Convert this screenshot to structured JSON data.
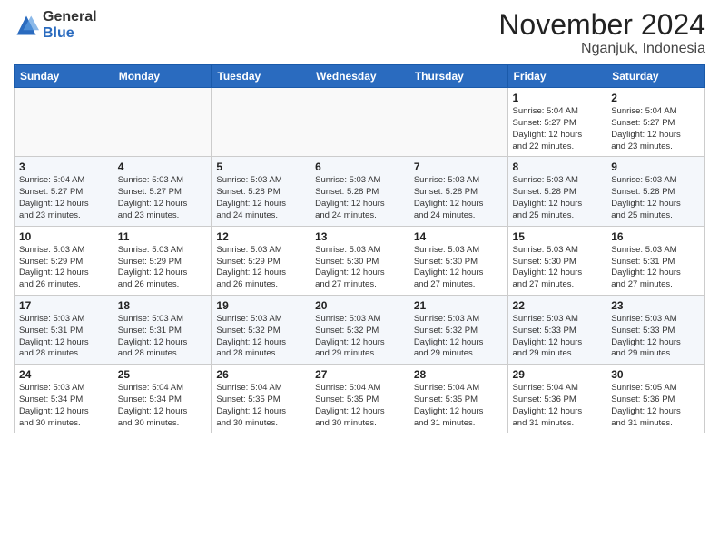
{
  "logo": {
    "general": "General",
    "blue": "Blue"
  },
  "title": "November 2024",
  "location": "Nganjuk, Indonesia",
  "days_of_week": [
    "Sunday",
    "Monday",
    "Tuesday",
    "Wednesday",
    "Thursday",
    "Friday",
    "Saturday"
  ],
  "weeks": [
    [
      {
        "day": "",
        "info": ""
      },
      {
        "day": "",
        "info": ""
      },
      {
        "day": "",
        "info": ""
      },
      {
        "day": "",
        "info": ""
      },
      {
        "day": "",
        "info": ""
      },
      {
        "day": "1",
        "info": "Sunrise: 5:04 AM\nSunset: 5:27 PM\nDaylight: 12 hours\nand 22 minutes."
      },
      {
        "day": "2",
        "info": "Sunrise: 5:04 AM\nSunset: 5:27 PM\nDaylight: 12 hours\nand 23 minutes."
      }
    ],
    [
      {
        "day": "3",
        "info": "Sunrise: 5:04 AM\nSunset: 5:27 PM\nDaylight: 12 hours\nand 23 minutes."
      },
      {
        "day": "4",
        "info": "Sunrise: 5:03 AM\nSunset: 5:27 PM\nDaylight: 12 hours\nand 23 minutes."
      },
      {
        "day": "5",
        "info": "Sunrise: 5:03 AM\nSunset: 5:28 PM\nDaylight: 12 hours\nand 24 minutes."
      },
      {
        "day": "6",
        "info": "Sunrise: 5:03 AM\nSunset: 5:28 PM\nDaylight: 12 hours\nand 24 minutes."
      },
      {
        "day": "7",
        "info": "Sunrise: 5:03 AM\nSunset: 5:28 PM\nDaylight: 12 hours\nand 24 minutes."
      },
      {
        "day": "8",
        "info": "Sunrise: 5:03 AM\nSunset: 5:28 PM\nDaylight: 12 hours\nand 25 minutes."
      },
      {
        "day": "9",
        "info": "Sunrise: 5:03 AM\nSunset: 5:28 PM\nDaylight: 12 hours\nand 25 minutes."
      }
    ],
    [
      {
        "day": "10",
        "info": "Sunrise: 5:03 AM\nSunset: 5:29 PM\nDaylight: 12 hours\nand 26 minutes."
      },
      {
        "day": "11",
        "info": "Sunrise: 5:03 AM\nSunset: 5:29 PM\nDaylight: 12 hours\nand 26 minutes."
      },
      {
        "day": "12",
        "info": "Sunrise: 5:03 AM\nSunset: 5:29 PM\nDaylight: 12 hours\nand 26 minutes."
      },
      {
        "day": "13",
        "info": "Sunrise: 5:03 AM\nSunset: 5:30 PM\nDaylight: 12 hours\nand 27 minutes."
      },
      {
        "day": "14",
        "info": "Sunrise: 5:03 AM\nSunset: 5:30 PM\nDaylight: 12 hours\nand 27 minutes."
      },
      {
        "day": "15",
        "info": "Sunrise: 5:03 AM\nSunset: 5:30 PM\nDaylight: 12 hours\nand 27 minutes."
      },
      {
        "day": "16",
        "info": "Sunrise: 5:03 AM\nSunset: 5:31 PM\nDaylight: 12 hours\nand 27 minutes."
      }
    ],
    [
      {
        "day": "17",
        "info": "Sunrise: 5:03 AM\nSunset: 5:31 PM\nDaylight: 12 hours\nand 28 minutes."
      },
      {
        "day": "18",
        "info": "Sunrise: 5:03 AM\nSunset: 5:31 PM\nDaylight: 12 hours\nand 28 minutes."
      },
      {
        "day": "19",
        "info": "Sunrise: 5:03 AM\nSunset: 5:32 PM\nDaylight: 12 hours\nand 28 minutes."
      },
      {
        "day": "20",
        "info": "Sunrise: 5:03 AM\nSunset: 5:32 PM\nDaylight: 12 hours\nand 29 minutes."
      },
      {
        "day": "21",
        "info": "Sunrise: 5:03 AM\nSunset: 5:32 PM\nDaylight: 12 hours\nand 29 minutes."
      },
      {
        "day": "22",
        "info": "Sunrise: 5:03 AM\nSunset: 5:33 PM\nDaylight: 12 hours\nand 29 minutes."
      },
      {
        "day": "23",
        "info": "Sunrise: 5:03 AM\nSunset: 5:33 PM\nDaylight: 12 hours\nand 29 minutes."
      }
    ],
    [
      {
        "day": "24",
        "info": "Sunrise: 5:03 AM\nSunset: 5:34 PM\nDaylight: 12 hours\nand 30 minutes."
      },
      {
        "day": "25",
        "info": "Sunrise: 5:04 AM\nSunset: 5:34 PM\nDaylight: 12 hours\nand 30 minutes."
      },
      {
        "day": "26",
        "info": "Sunrise: 5:04 AM\nSunset: 5:35 PM\nDaylight: 12 hours\nand 30 minutes."
      },
      {
        "day": "27",
        "info": "Sunrise: 5:04 AM\nSunset: 5:35 PM\nDaylight: 12 hours\nand 30 minutes."
      },
      {
        "day": "28",
        "info": "Sunrise: 5:04 AM\nSunset: 5:35 PM\nDaylight: 12 hours\nand 31 minutes."
      },
      {
        "day": "29",
        "info": "Sunrise: 5:04 AM\nSunset: 5:36 PM\nDaylight: 12 hours\nand 31 minutes."
      },
      {
        "day": "30",
        "info": "Sunrise: 5:05 AM\nSunset: 5:36 PM\nDaylight: 12 hours\nand 31 minutes."
      }
    ]
  ]
}
